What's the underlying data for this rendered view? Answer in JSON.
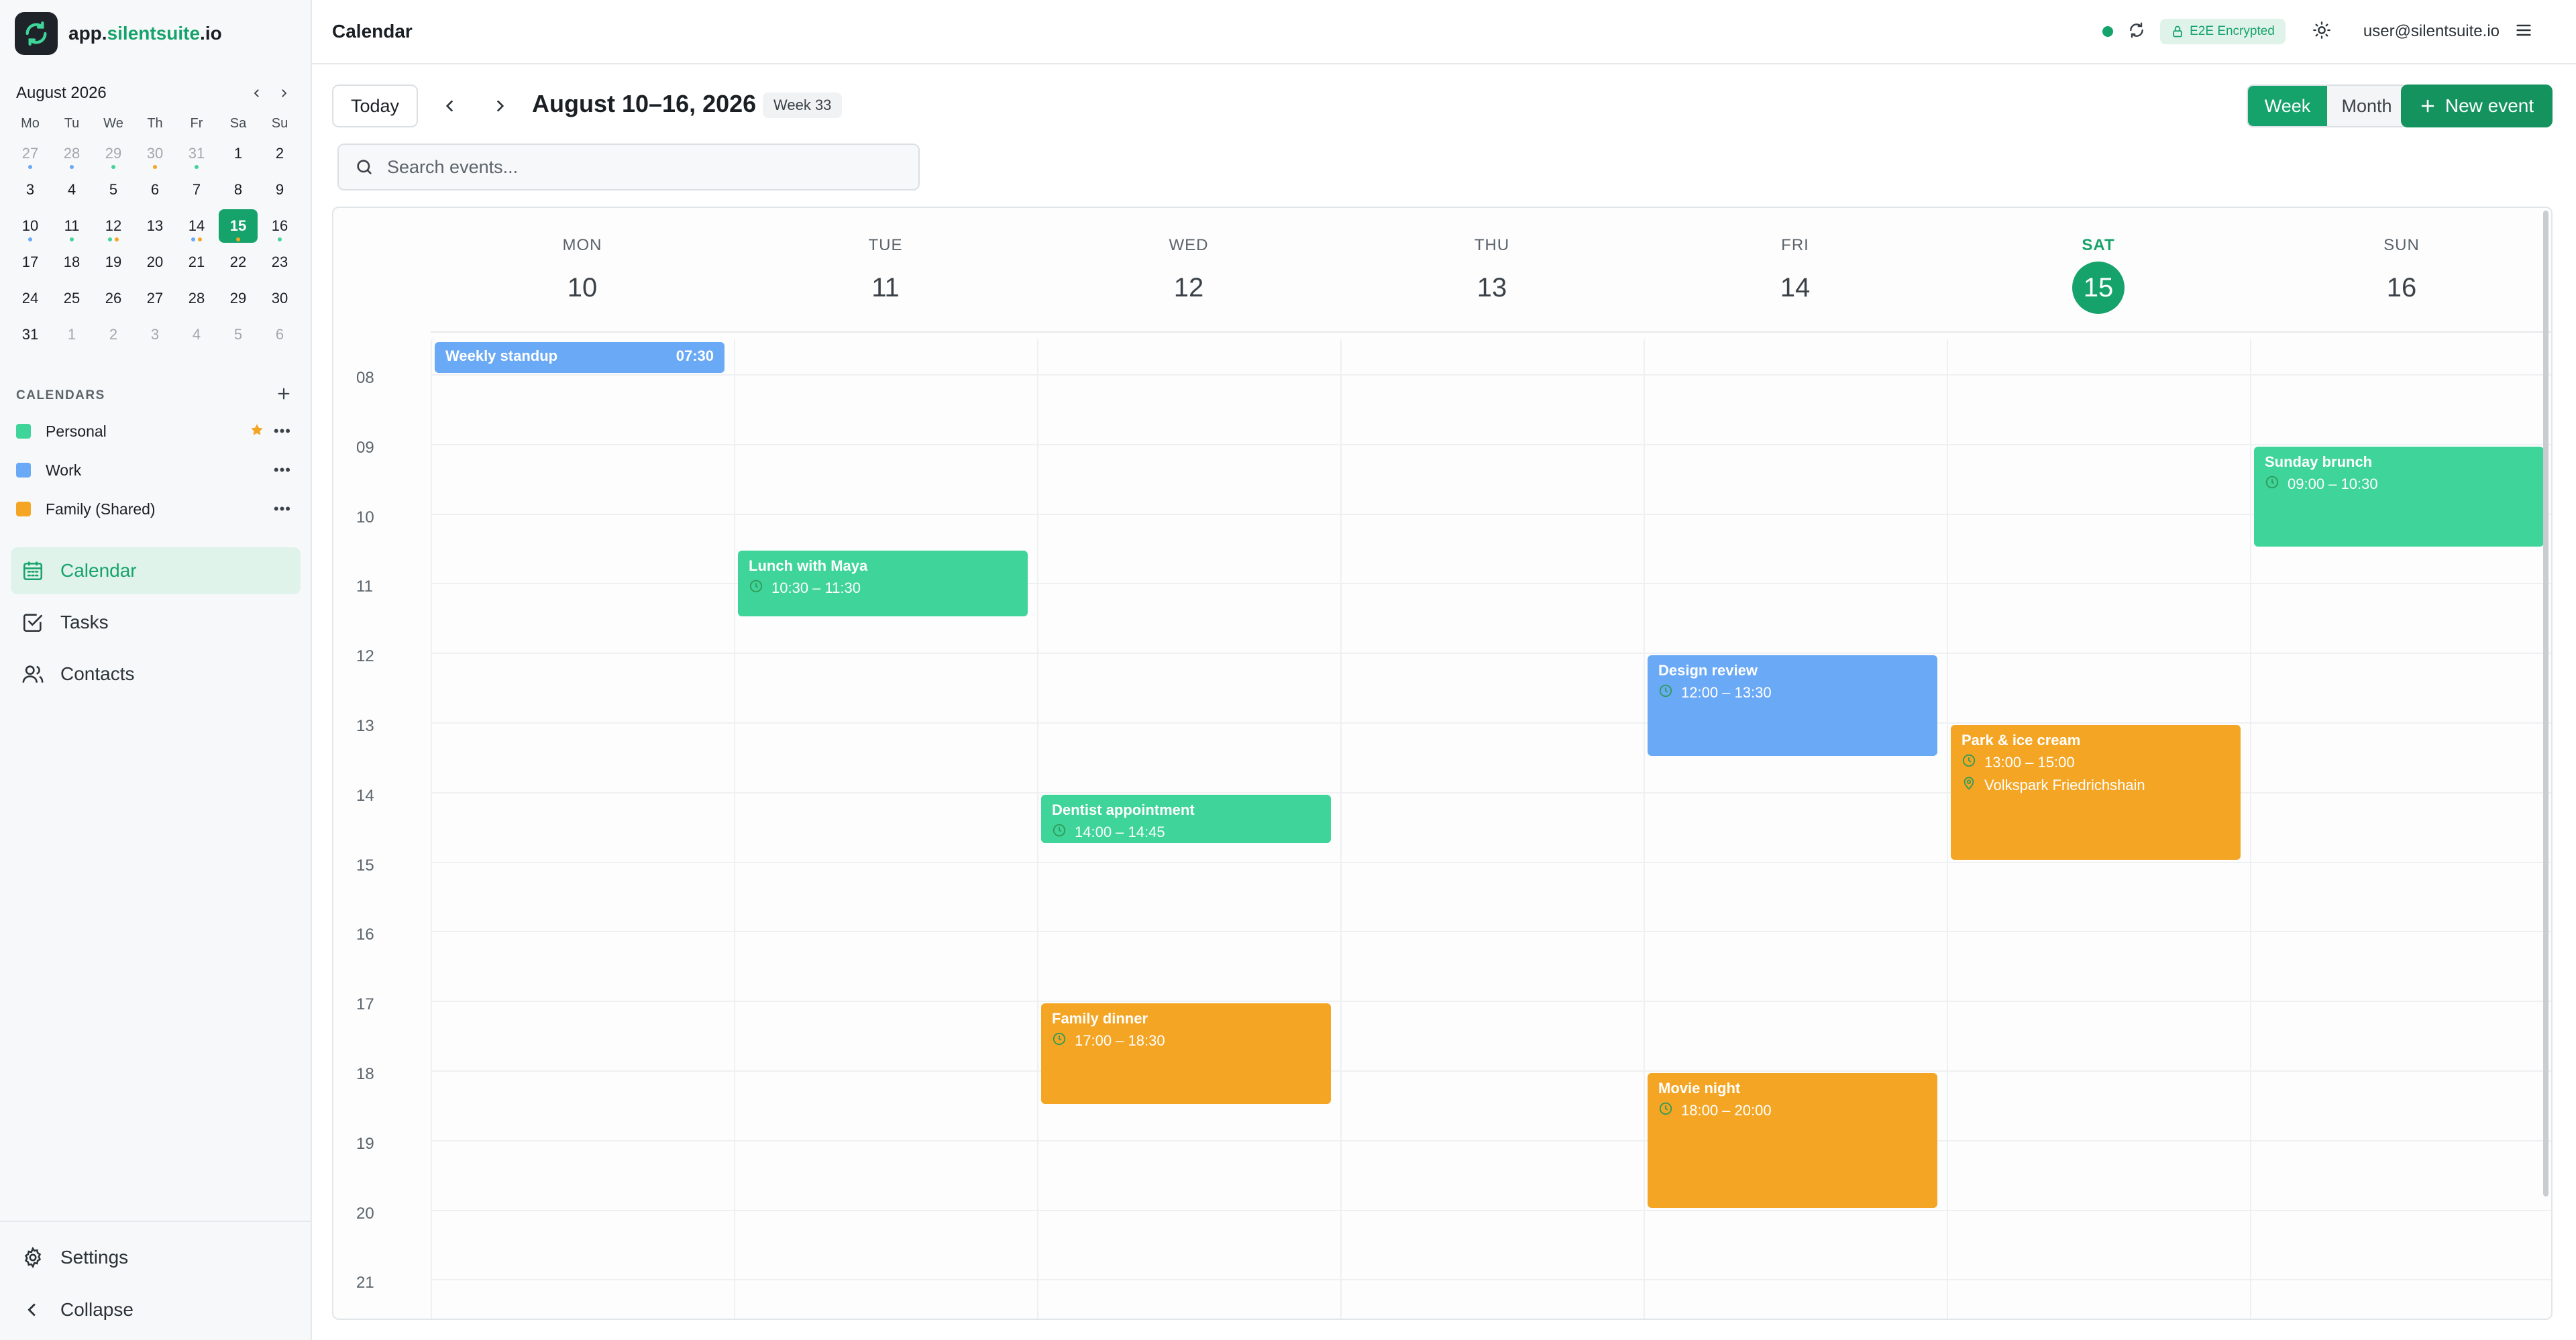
{
  "brand": {
    "name_prefix": "app.",
    "name_main": "silentsuite",
    "name_suffix": ".io"
  },
  "colors": {
    "accent": "#16a36b",
    "personal": "#3fd499",
    "work": "#6aa9f5",
    "family": "#f4a524"
  },
  "mini_calendar": {
    "title": "August 2026",
    "weekdays": [
      "Mo",
      "Tu",
      "We",
      "Th",
      "Fr",
      "Sa",
      "Su"
    ],
    "weeks": [
      [
        {
          "d": "27",
          "other": true,
          "dots": [
            "#6aa9f5"
          ]
        },
        {
          "d": "28",
          "other": true,
          "dots": [
            "#6aa9f5"
          ]
        },
        {
          "d": "29",
          "other": true,
          "dots": [
            "#3fd499"
          ]
        },
        {
          "d": "30",
          "other": true,
          "dots": [
            "#f4a524"
          ]
        },
        {
          "d": "31",
          "other": true,
          "dots": [
            "#3fd499"
          ]
        },
        {
          "d": "1"
        },
        {
          "d": "2"
        }
      ],
      [
        {
          "d": "3"
        },
        {
          "d": "4"
        },
        {
          "d": "5"
        },
        {
          "d": "6"
        },
        {
          "d": "7"
        },
        {
          "d": "8"
        },
        {
          "d": "9"
        }
      ],
      [
        {
          "d": "10",
          "dots": [
            "#6aa9f5"
          ]
        },
        {
          "d": "11",
          "dots": [
            "#3fd499"
          ]
        },
        {
          "d": "12",
          "dots": [
            "#3fd499",
            "#f4a524"
          ]
        },
        {
          "d": "13"
        },
        {
          "d": "14",
          "dots": [
            "#6aa9f5",
            "#f4a524"
          ]
        },
        {
          "d": "15",
          "selected": true,
          "dots": [
            "#f4a524"
          ]
        },
        {
          "d": "16",
          "dots": [
            "#3fd499"
          ]
        }
      ],
      [
        {
          "d": "17"
        },
        {
          "d": "18"
        },
        {
          "d": "19"
        },
        {
          "d": "20"
        },
        {
          "d": "21"
        },
        {
          "d": "22"
        },
        {
          "d": "23"
        }
      ],
      [
        {
          "d": "24"
        },
        {
          "d": "25"
        },
        {
          "d": "26"
        },
        {
          "d": "27"
        },
        {
          "d": "28"
        },
        {
          "d": "29"
        },
        {
          "d": "30"
        }
      ],
      [
        {
          "d": "31"
        },
        {
          "d": "1",
          "other": true
        },
        {
          "d": "2",
          "other": true
        },
        {
          "d": "3",
          "other": true
        },
        {
          "d": "4",
          "other": true
        },
        {
          "d": "5",
          "other": true
        },
        {
          "d": "6",
          "other": true
        }
      ]
    ]
  },
  "calendars": {
    "heading": "CALENDARS",
    "items": [
      {
        "name": "Personal",
        "color": "#3fd499",
        "default": true
      },
      {
        "name": "Work",
        "color": "#6aa9f5",
        "default": false
      },
      {
        "name": "Family (Shared)",
        "color": "#f4a524",
        "default": false
      }
    ]
  },
  "nav": {
    "calendar": "Calendar",
    "tasks": "Tasks",
    "contacts": "Contacts"
  },
  "footer": {
    "settings": "Settings",
    "collapse": "Collapse"
  },
  "topbar": {
    "title": "Calendar",
    "e2e": "E2E Encrypted",
    "user": "user@silentsuite.io"
  },
  "toolbar": {
    "today": "Today",
    "range": "August 10–16, 2026",
    "week_badge": "Week 33",
    "view_week": "Week",
    "view_month": "Month",
    "new_event": "New event"
  },
  "search": {
    "placeholder": "Search events..."
  },
  "week": {
    "days": [
      {
        "dow": "MON",
        "num": "10"
      },
      {
        "dow": "TUE",
        "num": "11"
      },
      {
        "dow": "WED",
        "num": "12"
      },
      {
        "dow": "THU",
        "num": "13"
      },
      {
        "dow": "FRI",
        "num": "14"
      },
      {
        "dow": "SAT",
        "num": "15",
        "today": true
      },
      {
        "dow": "SUN",
        "num": "16"
      }
    ],
    "hours": [
      "08",
      "09",
      "10",
      "11",
      "12",
      "13",
      "14",
      "15",
      "16",
      "17",
      "18",
      "19",
      "20",
      "21"
    ],
    "events": [
      {
        "title": "Weekly standup",
        "day": 0,
        "start": 7.5,
        "end": 8.0,
        "calendar": "work",
        "time": "07:30",
        "inline": true
      },
      {
        "title": "Lunch with Maya",
        "day": 1,
        "start": 10.5,
        "end": 11.5,
        "calendar": "personal",
        "time": "10:30 – 11:30"
      },
      {
        "title": "Dentist appointment",
        "day": 2,
        "start": 14.0,
        "end": 14.75,
        "calendar": "personal",
        "time": "14:00 – 14:45"
      },
      {
        "title": "Family dinner",
        "day": 2,
        "start": 17.0,
        "end": 18.5,
        "calendar": "family",
        "time": "17:00 – 18:30"
      },
      {
        "title": "Design review",
        "day": 4,
        "start": 12.0,
        "end": 13.5,
        "calendar": "work",
        "time": "12:00 – 13:30"
      },
      {
        "title": "Movie night",
        "day": 4,
        "start": 18.0,
        "end": 20.0,
        "calendar": "family",
        "time": "18:00 – 20:00"
      },
      {
        "title": "Park & ice cream",
        "day": 5,
        "start": 13.0,
        "end": 15.0,
        "calendar": "family",
        "time": "13:00 – 15:00",
        "location": "Volkspark Friedrichshain"
      },
      {
        "title": "Sunday brunch",
        "day": 6,
        "start": 9.0,
        "end": 10.5,
        "calendar": "personal",
        "time": "09:00 – 10:30"
      }
    ]
  }
}
